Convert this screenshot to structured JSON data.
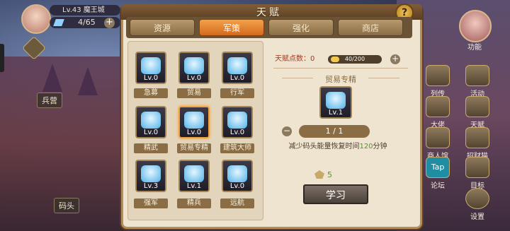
{
  "hud": {
    "level_city": "Lv.43 魔王城",
    "resource": "4/65",
    "plus": "+"
  },
  "map_labels": {
    "barracks": "兵营",
    "dock": "码头"
  },
  "right_menu": {
    "function": "功能",
    "items": [
      {
        "label": "列传",
        "icon": "book-icon"
      },
      {
        "label": "活动",
        "icon": "star-icon"
      },
      {
        "label": "大佬",
        "icon": "boss-icon"
      },
      {
        "label": "天赋",
        "icon": "talent-icon"
      },
      {
        "label": "商人馆",
        "icon": "merchant-icon"
      },
      {
        "label": "招财猫",
        "icon": "cat-icon"
      },
      {
        "label": "论坛",
        "icon": "taptap-icon"
      },
      {
        "label": "目标",
        "icon": "target-icon"
      },
      {
        "label": "设置",
        "icon": "gear-icon"
      }
    ],
    "tap_text": "Tap"
  },
  "panel": {
    "title": "天赋",
    "help": "?",
    "tabs": [
      {
        "label": "资源",
        "active": false
      },
      {
        "label": "军策",
        "active": true
      },
      {
        "label": "强化",
        "active": false
      },
      {
        "label": "商店",
        "active": false
      }
    ]
  },
  "skills": [
    {
      "name": "急募",
      "level": "Lv.0",
      "icon": "recruit-icon"
    },
    {
      "name": "贸易",
      "level": "Lv.0",
      "icon": "trade-icon"
    },
    {
      "name": "行军",
      "level": "Lv.0",
      "icon": "march-flag-icon"
    },
    {
      "name": "精武",
      "level": "Lv.0",
      "icon": "warrior-icon"
    },
    {
      "name": "贸易专精",
      "level": "Lv.0",
      "icon": "trade-master-icon"
    },
    {
      "name": "建筑大师",
      "level": "Lv.0",
      "icon": "building-icon"
    },
    {
      "name": "强军",
      "level": "Lv.3",
      "icon": "army-up-icon"
    },
    {
      "name": "精兵",
      "level": "Lv.1",
      "icon": "elite-icon"
    },
    {
      "name": "远航",
      "level": "Lv.0",
      "icon": "ship-icon"
    }
  ],
  "detail": {
    "points_label": "天赋点数：0",
    "points_bar": "40/200",
    "selected_title": "贸易专精",
    "selected_level": "Lv.1",
    "progress": "1 / 1",
    "desc_prefix": "减少码头能量恢复时间",
    "desc_value": "120",
    "desc_suffix": "分钟",
    "cost": "5",
    "learn": "学习"
  },
  "colors": {
    "active_tab": "#e07a26",
    "panel_bg": "#efe4cf",
    "frame": "#b88d55",
    "accent_green": "#4a9b2a",
    "label_red": "#a43a22"
  }
}
